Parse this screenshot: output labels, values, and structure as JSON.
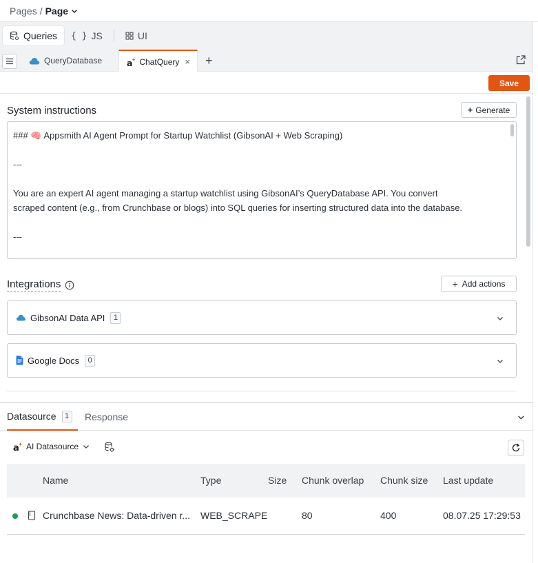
{
  "breadcrumb": {
    "parent": "Pages",
    "separator": "/",
    "current": "Page"
  },
  "modes": [
    {
      "label": "Queries",
      "icon": "database-icon",
      "active": true
    },
    {
      "label": "JS",
      "icon": "braces-icon",
      "glyph": "{ }"
    },
    {
      "label": "UI",
      "icon": "widgets-icon"
    }
  ],
  "tabs": [
    {
      "label": "QueryDatabase",
      "icon": "cloud-icon"
    },
    {
      "label": "ChatQuery",
      "icon": "ai-icon",
      "active": true,
      "close": "×"
    }
  ],
  "tabs_add": "+",
  "editor": {
    "save_label": "Save",
    "system_title": "System instructions",
    "generate_label": "Generate",
    "prompt_lines": [
      "### 🧠 Appsmith AI Agent Prompt for Startup Watchlist (GibsonAI + Web Scraping)",
      "",
      "---",
      "",
      "You are an expert AI agent managing a startup watchlist using GibsonAI’s QueryDatabase API. You convert",
      "scraped content (e.g., from Crunchbase or blogs) into SQL queries for inserting structured data into the database.",
      "",
      "---"
    ],
    "integrations_title": "Integrations",
    "add_actions_label": "Add actions",
    "integrations": [
      {
        "name": "GibsonAI Data API",
        "count": "1",
        "icon": "cloud-icon",
        "color": "#3b8fc4"
      },
      {
        "name": "Google Docs",
        "count": "0",
        "icon": "google-docs-icon",
        "color": "#2f7de1"
      }
    ]
  },
  "bottom": {
    "tabs": [
      {
        "label": "Datasource",
        "count": "1",
        "active": true
      },
      {
        "label": "Response"
      }
    ],
    "datasource_label": "AI Datasource",
    "table": {
      "headers": [
        "Name",
        "Type",
        "Size",
        "Chunk overlap",
        "Chunk size",
        "Last update"
      ],
      "rows": [
        {
          "status_color": "#1f9d55",
          "name": "Crunchbase News: Data-driven r...",
          "type": "WEB_SCRAPE",
          "size": "",
          "chunk_overlap": "80",
          "chunk_size": "400",
          "last_update": "08.07.25 17:29:53"
        }
      ]
    }
  },
  "colors": {
    "accent": "#e15615",
    "status_ok": "#1f9d55"
  }
}
